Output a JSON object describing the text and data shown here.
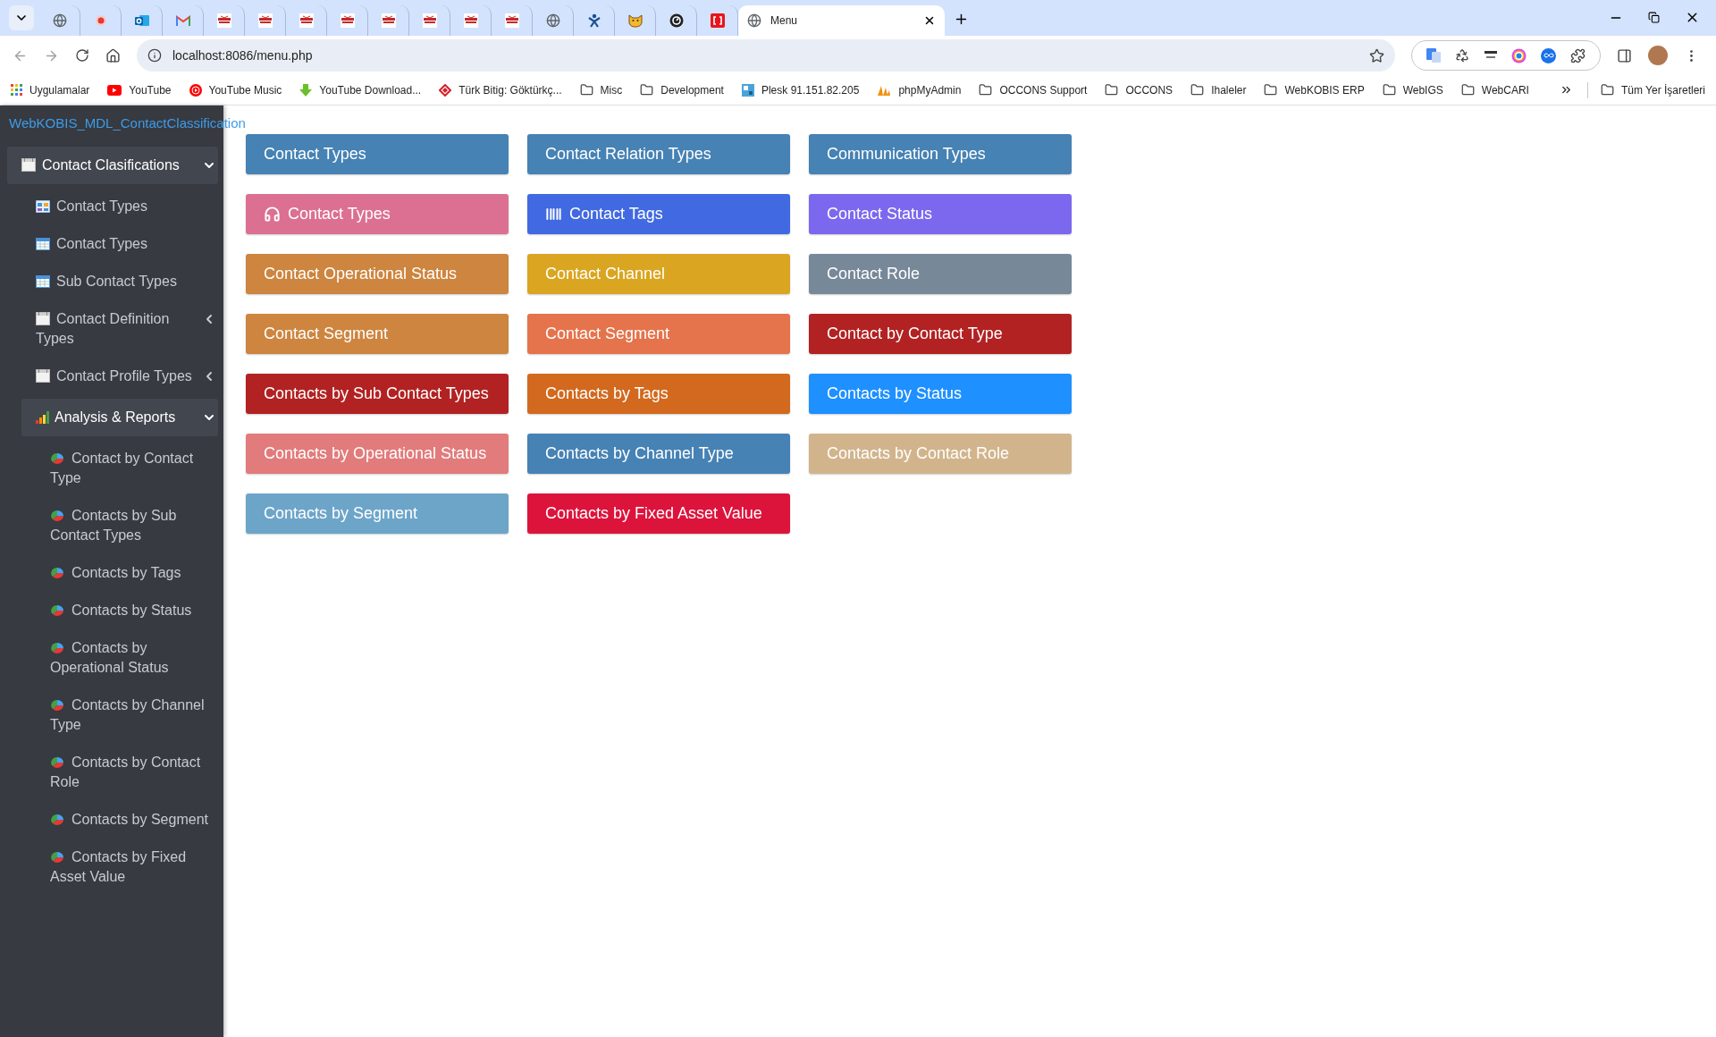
{
  "browser": {
    "tabs": [
      {
        "kind": "globe",
        "selected": false
      },
      {
        "kind": "record",
        "selected": false
      },
      {
        "kind": "outlook",
        "selected": false
      },
      {
        "kind": "gmail",
        "selected": false
      },
      {
        "kind": "logo",
        "selected": false
      },
      {
        "kind": "logo",
        "selected": false
      },
      {
        "kind": "logo",
        "selected": false
      },
      {
        "kind": "logo",
        "selected": false
      },
      {
        "kind": "logo",
        "selected": false
      },
      {
        "kind": "logo",
        "selected": false
      },
      {
        "kind": "logo",
        "selected": false
      },
      {
        "kind": "logo",
        "selected": false
      },
      {
        "kind": "globe",
        "selected": false
      },
      {
        "kind": "figure",
        "selected": false
      },
      {
        "kind": "cat",
        "selected": false
      },
      {
        "kind": "gauge",
        "selected": false
      },
      {
        "kind": "bracket",
        "selected": false
      },
      {
        "kind": "globe",
        "title": "Menu",
        "selected": true
      }
    ],
    "url": "localhost:8086/menu.php",
    "bookmarks": [
      {
        "kind": "apps",
        "label": "Uygulamalar"
      },
      {
        "kind": "youtube",
        "label": "YouTube"
      },
      {
        "kind": "ytmusic",
        "label": "YouTube Music"
      },
      {
        "kind": "download",
        "label": "YouTube Download..."
      },
      {
        "kind": "turk",
        "label": "Türk Bitig: Göktürkç..."
      },
      {
        "kind": "folder",
        "label": "Misc"
      },
      {
        "kind": "folder",
        "label": "Development"
      },
      {
        "kind": "plesk",
        "label": "Plesk 91.151.82.205"
      },
      {
        "kind": "pma",
        "label": "phpMyAdmin"
      },
      {
        "kind": "folder",
        "label": "OCCONS Support"
      },
      {
        "kind": "folder",
        "label": "OCCONS"
      },
      {
        "kind": "folder",
        "label": "Ihaleler"
      },
      {
        "kind": "folder",
        "label": "WebKOBIS ERP"
      },
      {
        "kind": "folder",
        "label": "WebIGS"
      },
      {
        "kind": "folder",
        "label": "WebCARI"
      }
    ],
    "all_bookmarks": "Tüm Yer İşaretleri"
  },
  "sidebar": {
    "title": "WebKOBIS_MDL_ContactClassification",
    "items": [
      {
        "kind": "window",
        "label": "Contact Clasifications",
        "expanded": true,
        "children": [
          {
            "kind": "grid",
            "label": "Contact Types"
          },
          {
            "kind": "table",
            "label": "Contact Types"
          },
          {
            "kind": "table",
            "label": "Sub Contact Types"
          },
          {
            "kind": "window",
            "label": "Contact Definition Types",
            "expanded": false
          },
          {
            "kind": "window",
            "label": "Contact Profile Types",
            "expanded": false
          },
          {
            "kind": "chart",
            "label": "Analysis & Reports",
            "expanded": true,
            "children": [
              {
                "kind": "pie",
                "label": "Contact by Contact Type"
              },
              {
                "kind": "pie",
                "label": "Contacts by Sub Contact Types"
              },
              {
                "kind": "pie",
                "label": "Contacts by Tags"
              },
              {
                "kind": "pie",
                "label": "Contacts by Status"
              },
              {
                "kind": "pie",
                "label": "Contacts by Operational Status"
              },
              {
                "kind": "pie",
                "label": "Contacts by Channel Type"
              },
              {
                "kind": "pie",
                "label": "Contacts by Contact Role"
              },
              {
                "kind": "pie",
                "label": "Contacts by Segment"
              },
              {
                "kind": "pie",
                "label": "Contacts by Fixed Asset Value"
              }
            ]
          }
        ]
      }
    ]
  },
  "menu_buttons": [
    {
      "kind": "plain",
      "label": "Contact Types",
      "color": "#4682b4"
    },
    {
      "kind": "plain",
      "label": "Contact Relation Types",
      "color": "#4682b4"
    },
    {
      "kind": "plain",
      "label": "Communication Types",
      "color": "#4682b4"
    },
    {
      "kind": "headphones",
      "label": "Contact Types",
      "color": "#db7093"
    },
    {
      "kind": "barcode",
      "label": "Contact Tags",
      "color": "#4169e1"
    },
    {
      "kind": "plain",
      "label": "Contact Status",
      "color": "#7b68ee"
    },
    {
      "kind": "plain",
      "label": "Contact Operational Status",
      "color": "#cd853f"
    },
    {
      "kind": "plain",
      "label": "Contact Channel",
      "color": "#daa520"
    },
    {
      "kind": "plain",
      "label": "Contact Role",
      "color": "#778899"
    },
    {
      "kind": "plain",
      "label": "Contact Segment",
      "color": "#cd853f"
    },
    {
      "kind": "plain",
      "label": "Contact Segment",
      "color": "#e5734c"
    },
    {
      "kind": "plain",
      "label": "Contact by Contact Type",
      "color": "#b22222"
    },
    {
      "kind": "plain",
      "label": "Contacts by Sub Contact Types",
      "color": "#b22222"
    },
    {
      "kind": "plain",
      "label": "Contacts by Tags",
      "color": "#d2691e"
    },
    {
      "kind": "plain",
      "label": "Contacts by Status",
      "color": "#1e90ff"
    },
    {
      "kind": "plain",
      "label": "Contacts by Operational Status",
      "color": "#e27b7b"
    },
    {
      "kind": "plain",
      "label": "Contacts by Channel Type",
      "color": "#4682b4"
    },
    {
      "kind": "plain",
      "label": "Contacts by Contact Role",
      "color": "#d2b48c"
    },
    {
      "kind": "plain",
      "label": "Contacts by Segment",
      "color": "#6da5c9"
    },
    {
      "kind": "plain",
      "label": "Contacts by Fixed Asset Value",
      "color": "#dc143c"
    }
  ]
}
